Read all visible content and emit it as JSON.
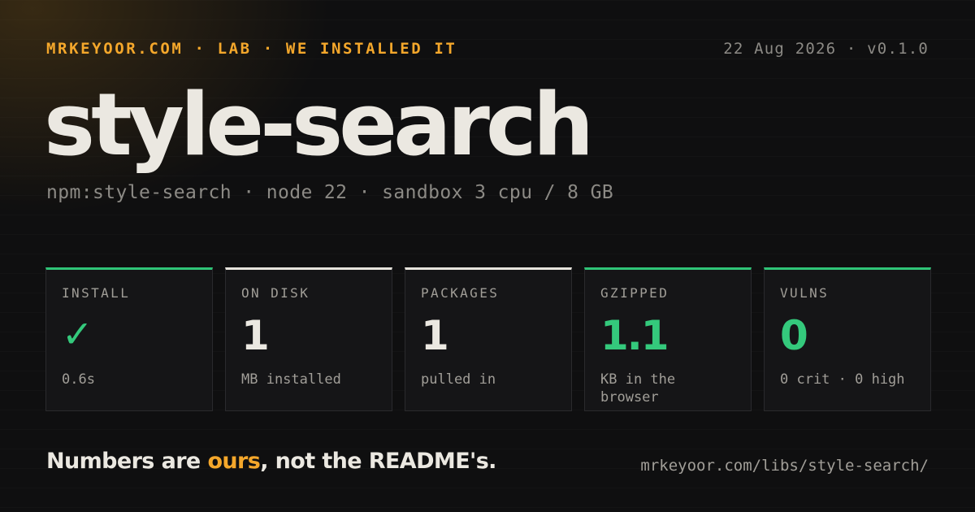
{
  "header": {
    "brand": "MRKEYOOR.COM · LAB · WE INSTALLED IT",
    "meta": "22 Aug 2026 · v0.1.0"
  },
  "title": "style-search",
  "subtitle": "npm:style-search · node 22 · sandbox 3 cpu / 8 GB",
  "colors": {
    "accent": "#f4a72b",
    "good": "#34c97c",
    "neutral": "#e6e3dc",
    "background": "#0f0f10"
  },
  "cards": [
    {
      "label": "INSTALL",
      "value": "✓",
      "note": "0.6s",
      "status": "good",
      "icon": "checkmark-icon"
    },
    {
      "label": "ON DISK",
      "value": "1",
      "note": "MB installed",
      "status": "neutral"
    },
    {
      "label": "PACKAGES",
      "value": "1",
      "note": "pulled in",
      "status": "neutral"
    },
    {
      "label": "GZIPPED",
      "value": "1.1",
      "note": "KB in the browser",
      "status": "good"
    },
    {
      "label": "VULNS",
      "value": "0",
      "note": "0 crit · 0 high",
      "status": "good"
    }
  ],
  "tagline": {
    "before": "Numbers are ",
    "accent": "ours",
    "after": ", not the README's."
  },
  "url": "mrkeyoor.com/libs/style-search/"
}
